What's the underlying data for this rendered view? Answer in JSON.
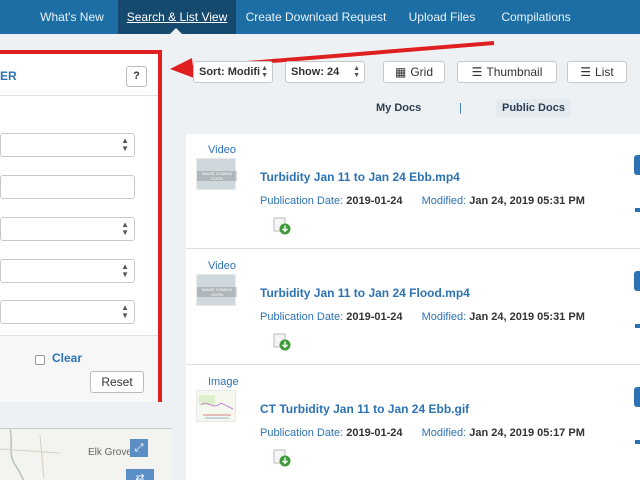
{
  "nav": {
    "items": [
      "What's New",
      "Search & List View",
      "Create Download Request",
      "Upload Files",
      "Compilations"
    ],
    "active": "Search & List View"
  },
  "filter": {
    "title": "ER",
    "help_label": "?",
    "clear_label": "Clear",
    "reset_label": "Reset"
  },
  "map": {
    "place_label": "Elk Grove",
    "expand_icon": "expand-icon",
    "swap_icon": "swap-arrows-icon"
  },
  "toolbar": {
    "sort_label": "Sort: Modifi",
    "show_label": "Show: 24",
    "grid_label": "Grid",
    "thumbnail_label": "Thumbnail",
    "list_label": "List"
  },
  "tabs": {
    "my_docs": "My Docs",
    "separator": "|",
    "public_docs": "Public Docs"
  },
  "results": [
    {
      "type": "Video",
      "thumb_caption": "IMAGE COMING SOON",
      "title": "Turbidity Jan 11 to Jan 24 Ebb.mp4",
      "pub_label": "Publication Date:",
      "pub_date": "2019-01-24",
      "mod_label": "Modified:",
      "mod_date": "Jan 24, 2019 05:31 PM"
    },
    {
      "type": "Video",
      "thumb_caption": "IMAGE COMING SOON",
      "title": "Turbidity Jan 11 to Jan 24 Flood.mp4",
      "pub_label": "Publication Date:",
      "pub_date": "2019-01-24",
      "mod_label": "Modified:",
      "mod_date": "Jan 24, 2019 05:31 PM"
    },
    {
      "type": "Image",
      "thumb_caption": "",
      "title": "CT Turbidity Jan 11 to Jan 24 Ebb.gif",
      "pub_label": "Publication Date:",
      "pub_date": "2019-01-24",
      "mod_label": "Modified:",
      "mod_date": "Jan 24, 2019 05:17 PM"
    }
  ],
  "colors": {
    "nav_bg": "#1c6ea4",
    "nav_active": "#15496e",
    "link": "#2d73b4",
    "highlight": "#e02020"
  }
}
